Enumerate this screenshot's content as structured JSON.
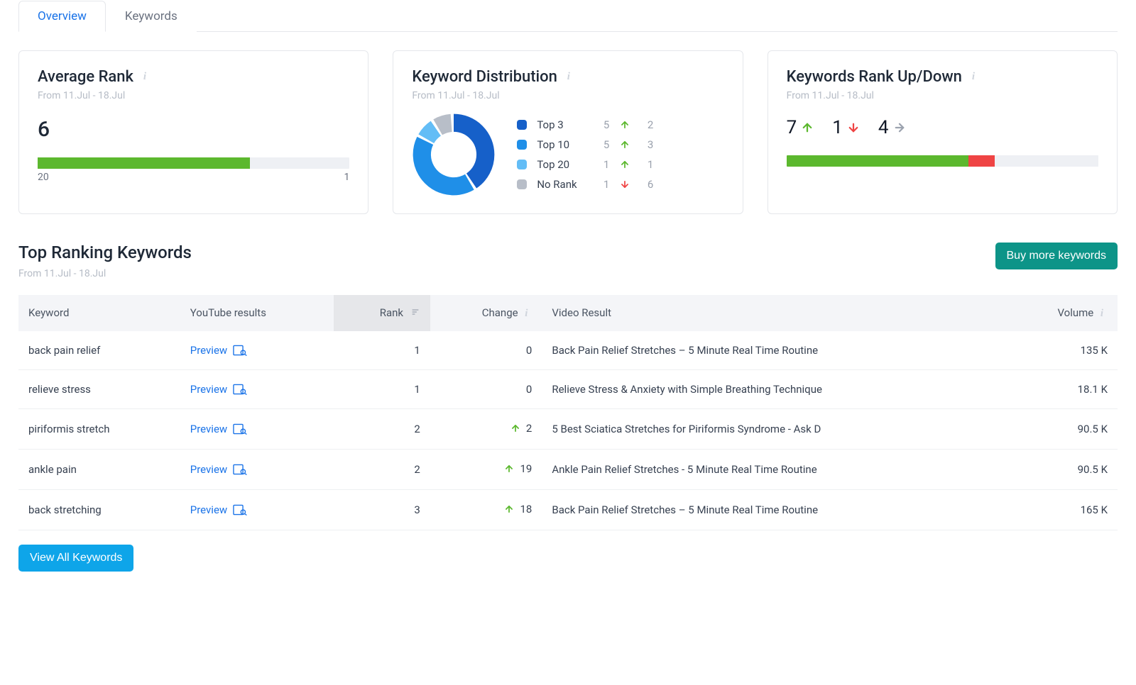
{
  "tabs": [
    {
      "label": "Overview",
      "active": true
    },
    {
      "label": "Keywords",
      "active": false
    }
  ],
  "avg_rank": {
    "title": "Average Rank",
    "date_range": "From 11.Jul - 18.Jul",
    "value": "6",
    "bar_min": "20",
    "bar_max": "1",
    "fill_pct": 68
  },
  "distribution": {
    "title": "Keyword Distribution",
    "date_range": "From 11.Jul - 18.Jul",
    "legend": [
      {
        "label": "Top 3",
        "count": 5,
        "change_dir": "up",
        "change": 2,
        "color": "#1660c9"
      },
      {
        "label": "Top 10",
        "count": 5,
        "change_dir": "up",
        "change": 3,
        "color": "#1f8fe8"
      },
      {
        "label": "Top 20",
        "count": 1,
        "change_dir": "up",
        "change": 1,
        "color": "#63bdf6"
      },
      {
        "label": "No Rank",
        "count": 1,
        "change_dir": "down",
        "change": 6,
        "color": "#b8bec8"
      }
    ]
  },
  "updown": {
    "title": "Keywords Rank Up/Down",
    "date_range": "From 11.Jul - 18.Jul",
    "up": 7,
    "down": 1,
    "flat": 4
  },
  "section": {
    "title": "Top Ranking Keywords",
    "date_range": "From 11.Jul - 18.Jul",
    "buy_btn": "Buy more keywords",
    "view_all_btn": "View All Keywords"
  },
  "table": {
    "columns": [
      "Keyword",
      "YouTube results",
      "Rank",
      "Change",
      "Video Result",
      "Volume"
    ],
    "preview_label": "Preview",
    "rows": [
      {
        "keyword": "back pain relief",
        "rank": 1,
        "change_dir": "none",
        "change": 0,
        "video": "Back Pain Relief Stretches – 5 Minute Real Time Routine",
        "volume": "135 K"
      },
      {
        "keyword": "relieve stress",
        "rank": 1,
        "change_dir": "none",
        "change": 0,
        "video": "Relieve Stress & Anxiety with Simple Breathing Technique",
        "volume": "18.1 K"
      },
      {
        "keyword": "piriformis stretch",
        "rank": 2,
        "change_dir": "up",
        "change": 2,
        "video": "5 Best Sciatica Stretches for Piriformis Syndrome - Ask D",
        "volume": "90.5 K"
      },
      {
        "keyword": "ankle pain",
        "rank": 2,
        "change_dir": "up",
        "change": 19,
        "video": "Ankle Pain Relief Stretches - 5 Minute Real Time Routine",
        "volume": "90.5 K"
      },
      {
        "keyword": "back stretching",
        "rank": 3,
        "change_dir": "up",
        "change": 18,
        "video": "Back Pain Relief Stretches – 5 Minute Real Time Routine",
        "volume": "165 K"
      }
    ]
  },
  "chart_data": {
    "type": "pie",
    "title": "Keyword Distribution",
    "categories": [
      "Top 3",
      "Top 10",
      "Top 20",
      "No Rank"
    ],
    "values": [
      5,
      5,
      1,
      1
    ],
    "colors": [
      "#1660c9",
      "#1f8fe8",
      "#63bdf6",
      "#b8bec8"
    ]
  },
  "colors": {
    "green": "#5cb82e",
    "red": "#ef4444",
    "gray": "#9ca3af",
    "link": "#1a73e8",
    "teal": "#0d9488",
    "blue_btn": "#0ea5e9"
  }
}
